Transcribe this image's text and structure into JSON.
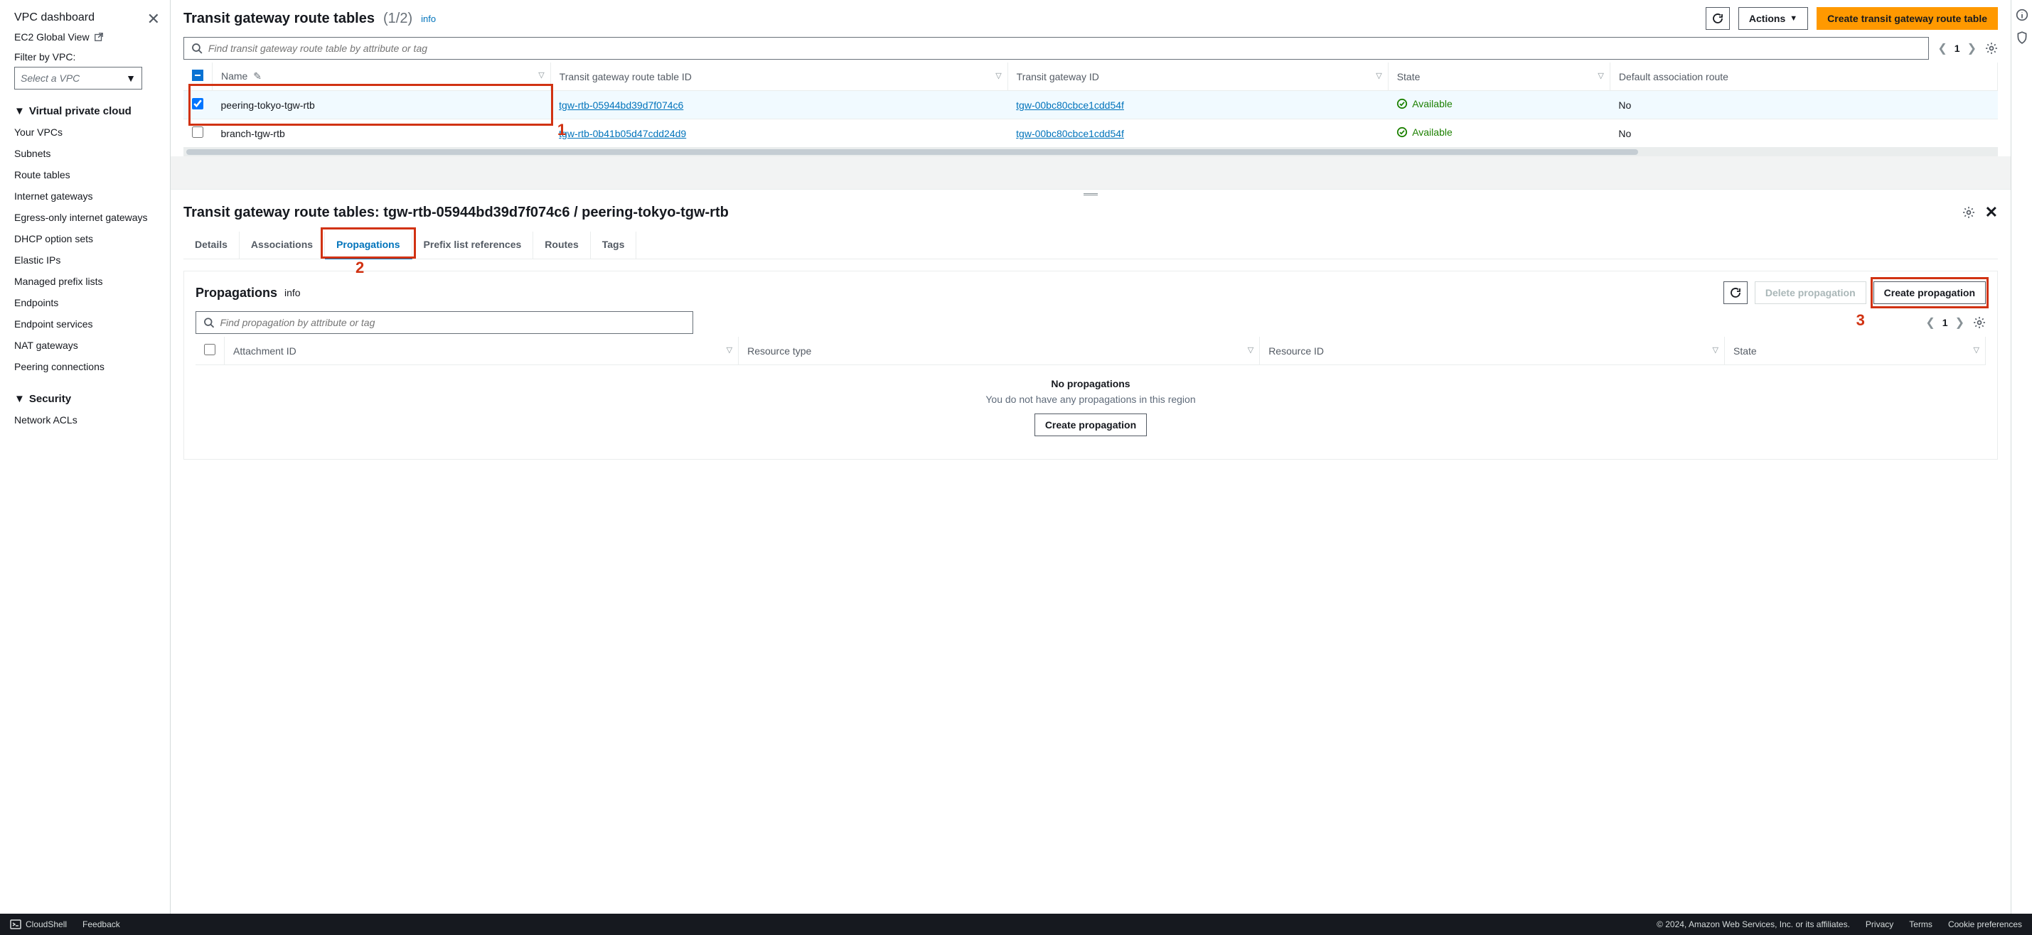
{
  "sidebar": {
    "dashboard": "VPC dashboard",
    "ec2_global": "EC2 Global View",
    "filter_label": "Filter by VPC:",
    "vpc_select_placeholder": "Select a VPC",
    "sections": {
      "vpc": {
        "label": "Virtual private cloud",
        "items": [
          "Your VPCs",
          "Subnets",
          "Route tables",
          "Internet gateways",
          "Egress-only internet gateways",
          "DHCP option sets",
          "Elastic IPs",
          "Managed prefix lists",
          "Endpoints",
          "Endpoint services",
          "NAT gateways",
          "Peering connections"
        ]
      },
      "security": {
        "label": "Security",
        "items": [
          "Network ACLs"
        ]
      }
    }
  },
  "top": {
    "title": "Transit gateway route tables",
    "count": "(1/2)",
    "info": "info",
    "actions_btn": "Actions",
    "create_btn": "Create transit gateway route table",
    "search_placeholder": "Find transit gateway route table by attribute or tag",
    "page": "1",
    "columns": [
      "Name",
      "Transit gateway route table ID",
      "Transit gateway ID",
      "State",
      "Default association route"
    ],
    "rows": [
      {
        "selected": true,
        "name": "peering-tokyo-tgw-rtb",
        "rtb_id": "tgw-rtb-05944bd39d7f074c6",
        "tgw_id": "tgw-00bc80cbce1cdd54f",
        "state": "Available",
        "def_assoc": "No"
      },
      {
        "selected": false,
        "name": "branch-tgw-rtb",
        "rtb_id": "tgw-rtb-0b41b05d47cdd24d9",
        "tgw_id": "tgw-00bc80cbce1cdd54f",
        "state": "Available",
        "def_assoc": "No"
      }
    ]
  },
  "bottom": {
    "title": "Transit gateway route tables: tgw-rtb-05944bd39d7f074c6 / peering-tokyo-tgw-rtb",
    "tabs": [
      "Details",
      "Associations",
      "Propagations",
      "Prefix list references",
      "Routes",
      "Tags"
    ],
    "active_tab": 2,
    "prop": {
      "title": "Propagations",
      "info": "info",
      "delete_btn": "Delete propagation",
      "create_btn": "Create propagation",
      "search_placeholder": "Find propagation by attribute or tag",
      "page": "1",
      "columns": [
        "Attachment ID",
        "Resource type",
        "Resource ID",
        "State"
      ],
      "empty_title": "No propagations",
      "empty_sub": "You do not have any propagations in this region",
      "empty_btn": "Create propagation"
    }
  },
  "annotations": {
    "n1": "1",
    "n2": "2",
    "n3": "3"
  },
  "footer": {
    "cloudshell": "CloudShell",
    "feedback": "Feedback",
    "copyright": "© 2024, Amazon Web Services, Inc. or its affiliates.",
    "privacy": "Privacy",
    "terms": "Terms",
    "cookies": "Cookie preferences"
  }
}
